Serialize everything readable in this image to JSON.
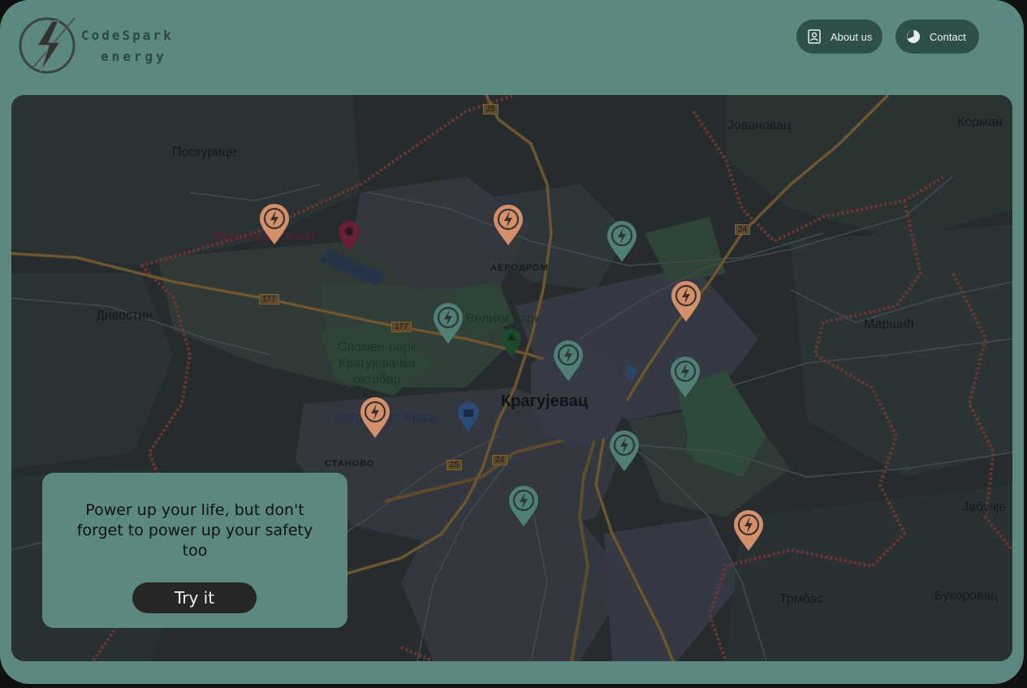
{
  "brand": {
    "line1": "CodeSpark",
    "line2": "energy"
  },
  "nav": {
    "about_label": "About us",
    "contact_label": "Contact"
  },
  "map": {
    "labels": {
      "poskurice": "Поскурице",
      "jovanovac": "Јовановац",
      "korman": "Корман",
      "woodland": "Woodland Resort",
      "aerodrom": "АЕРОДРОМ",
      "divostin": "Дивостин",
      "veliki_park": "Велики парк",
      "spomen_park": "Спомен-парк\nКрагујевачки\nоктобар",
      "marsic": "Маршић",
      "kragujevac": "Крагујевац",
      "plaza": "Kragujevac Plaza",
      "stanovo": "СТАНОВО",
      "jabucje": "Јабучје",
      "trmbas": "Трмбас",
      "bukorovac": "Букоровац"
    },
    "road_shields": {
      "r25a": "25",
      "r24a": "24",
      "r177a": "177",
      "r177b": "177",
      "r25b": "25",
      "r24b": "24"
    },
    "pin_colors": {
      "available": "#d4906a",
      "busy": "#4f7f77"
    },
    "pins": [
      {
        "status": "available"
      },
      {
        "status": "available"
      },
      {
        "status": "busy"
      },
      {
        "status": "available"
      },
      {
        "status": "busy"
      },
      {
        "status": "busy"
      },
      {
        "status": "busy"
      },
      {
        "status": "available"
      },
      {
        "status": "busy"
      },
      {
        "status": "busy"
      },
      {
        "status": "available"
      }
    ]
  },
  "promo": {
    "text": "Power up your life, but don't forget to power up your safety too",
    "button_label": "Try it"
  }
}
